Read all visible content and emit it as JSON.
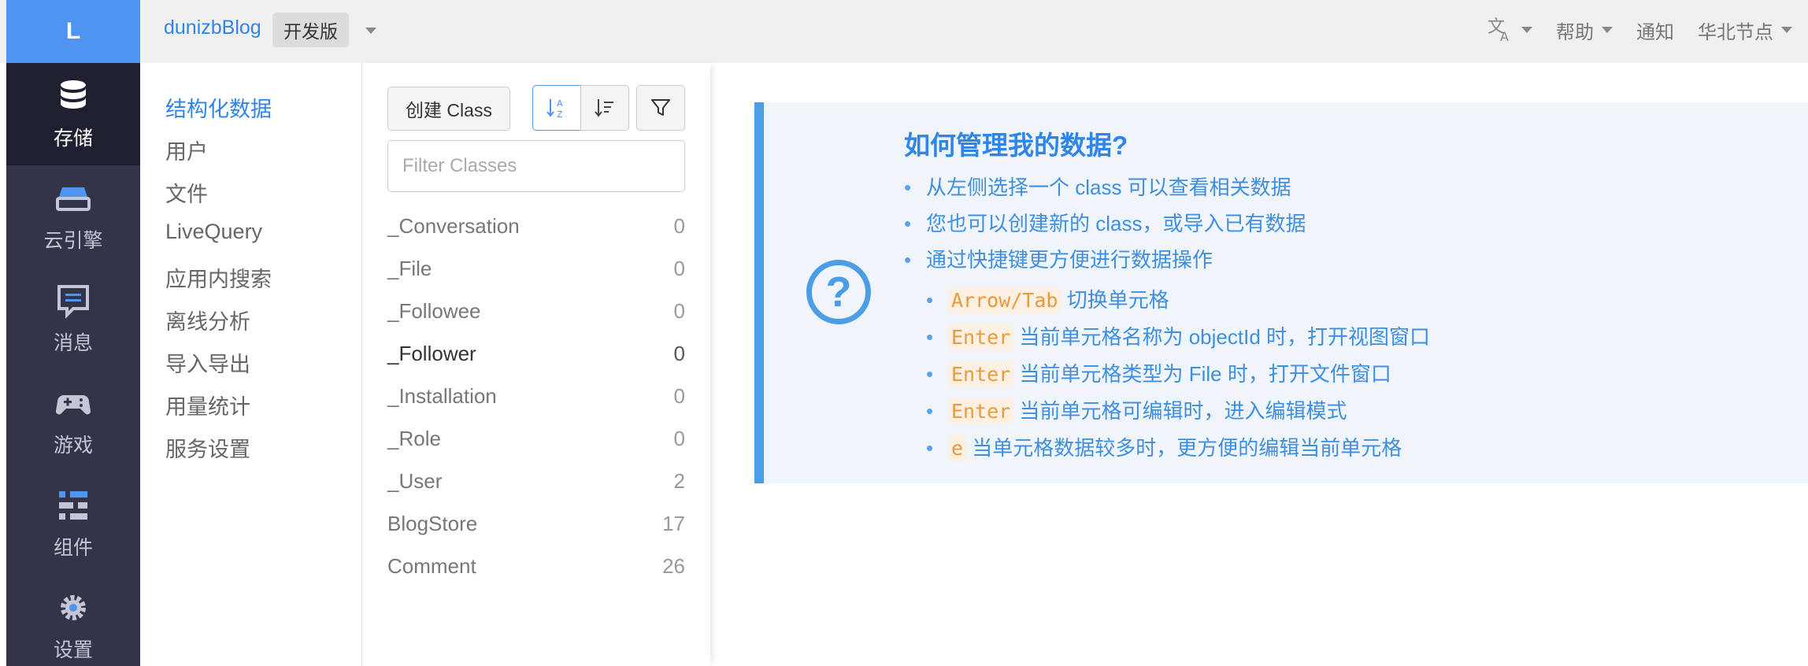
{
  "logo": {
    "letter": "L"
  },
  "header": {
    "app_name": "dunizbBlog",
    "env_badge": "开发版",
    "right_items": [
      "帮助",
      "通知",
      "华北节点"
    ],
    "translate_icon": "translate-icon"
  },
  "leftnav": {
    "items": [
      {
        "label": "存储",
        "icon": "database-icon",
        "active": true
      },
      {
        "label": "云引擎",
        "icon": "cloud-engine-icon"
      },
      {
        "label": "消息",
        "icon": "message-icon"
      },
      {
        "label": "游戏",
        "icon": "gamepad-icon"
      },
      {
        "label": "组件",
        "icon": "components-icon"
      },
      {
        "label": "设置",
        "icon": "gear-icon"
      }
    ]
  },
  "submenu": {
    "items": [
      "结构化数据",
      "用户",
      "文件",
      "LiveQuery",
      "应用内搜索",
      "离线分析",
      "导入导出",
      "用量统计",
      "服务设置"
    ]
  },
  "classes": {
    "create_label": "创建 Class",
    "filter_placeholder": "Filter Classes",
    "rows": [
      {
        "name": "_Conversation",
        "count": "0"
      },
      {
        "name": "_File",
        "count": "0"
      },
      {
        "name": "_Followee",
        "count": "0"
      },
      {
        "name": "_Follower",
        "count": "0"
      },
      {
        "name": "_Installation",
        "count": "0"
      },
      {
        "name": "_Role",
        "count": "0"
      },
      {
        "name": "_User",
        "count": "2"
      },
      {
        "name": "BlogStore",
        "count": "17"
      },
      {
        "name": "Comment",
        "count": "26"
      }
    ]
  },
  "help": {
    "title": "如何管理我的数据?",
    "bullets": [
      "从左侧选择一个 class 可以查看相关数据",
      "您也可以创建新的 class，或导入已有数据",
      "通过快捷键更方便进行数据操作"
    ],
    "shortcuts": [
      {
        "key": "Arrow/Tab",
        "desc": "切换单元格"
      },
      {
        "key": "Enter",
        "desc": "当前单元格名称为 objectId 时，打开视图窗口"
      },
      {
        "key": "Enter",
        "desc": "当前单元格类型为 File 时，打开文件窗口"
      },
      {
        "key": "Enter",
        "desc": "当前单元格可编辑时，进入编辑模式"
      },
      {
        "key": "e",
        "desc": "当单元格数据较多时，更方便的编辑当前单元格"
      }
    ]
  }
}
